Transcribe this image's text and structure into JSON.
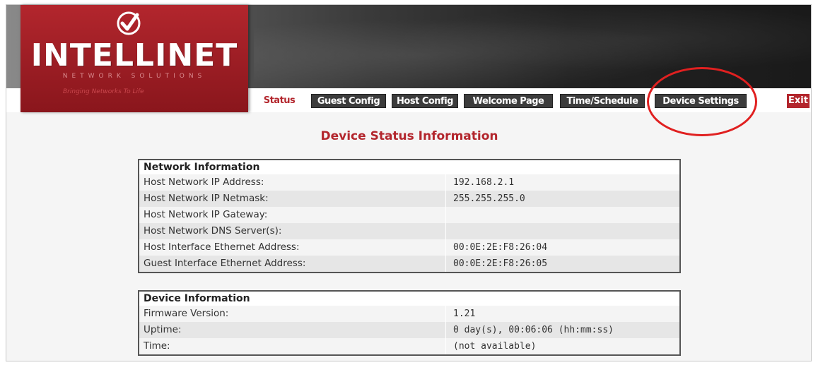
{
  "brand": {
    "name": "INTELLINET",
    "subtitle": "NETWORK SOLUTIONS",
    "tagline": "Bringing Networks To Life"
  },
  "nav": {
    "items": [
      {
        "label": "Status",
        "active": true
      },
      {
        "label": "Guest Config",
        "active": false
      },
      {
        "label": "Host Config",
        "active": false
      },
      {
        "label": "Welcome Page",
        "active": false
      },
      {
        "label": "Time/Schedule",
        "active": false
      },
      {
        "label": "Device Settings",
        "active": false
      }
    ],
    "exit_label": "Exit"
  },
  "page": {
    "title": "Device Status Information"
  },
  "network_info": {
    "heading": "Network Information",
    "rows": [
      {
        "label": "Host Network IP Address:",
        "value": "192.168.2.1"
      },
      {
        "label": "Host Network IP Netmask:",
        "value": "255.255.255.0"
      },
      {
        "label": "Host Network IP Gateway:",
        "value": ""
      },
      {
        "label": "Host Network DNS Server(s):",
        "value": ""
      },
      {
        "label": "Host Interface Ethernet Address:",
        "value": "00:0E:2E:F8:26:04"
      },
      {
        "label": "Guest Interface Ethernet Address:",
        "value": "00:0E:2E:F8:26:05"
      }
    ]
  },
  "device_info": {
    "heading": "Device Information",
    "rows": [
      {
        "label": "Firmware Version:",
        "value": "1.21"
      },
      {
        "label": "Uptime:",
        "value": "0 day(s), 00:06:06 (hh:mm:ss)"
      },
      {
        "label": "Time:",
        "value": "(not available)"
      }
    ]
  },
  "colors": {
    "brand_red": "#b3262d",
    "highlight": "#e02020",
    "nav_bg": "#3c3c3c"
  }
}
